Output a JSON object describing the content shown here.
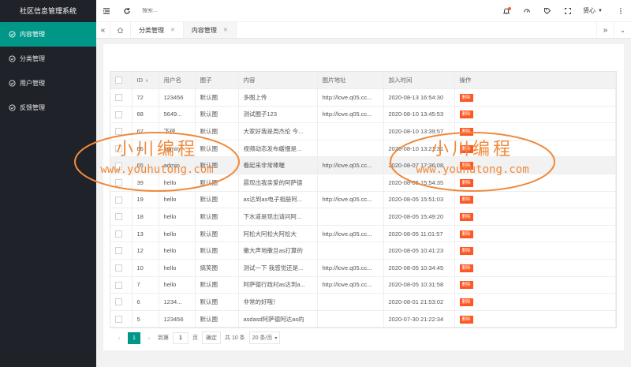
{
  "app": {
    "title": "社区信息管理系统"
  },
  "sidebar": {
    "items": [
      {
        "label": "内容管理",
        "icon": "check-circle-icon",
        "active": true
      },
      {
        "label": "分类管理",
        "icon": "check-circle-icon",
        "active": false
      },
      {
        "label": "用户管理",
        "icon": "check-circle-icon",
        "active": false
      },
      {
        "label": "反馈管理",
        "icon": "check-circle-icon",
        "active": false
      }
    ]
  },
  "header": {
    "search_placeholder": "搜索...",
    "user": "贤心"
  },
  "tabs": [
    {
      "label": "分类管理",
      "active": false
    },
    {
      "label": "内容管理",
      "active": true
    }
  ],
  "table": {
    "columns": [
      "ID",
      "用户名",
      "圈子",
      "内容",
      "图片地址",
      "加入时间",
      "操作"
    ],
    "delete_label": "删除",
    "rows": [
      {
        "id": "72",
        "user": "123456",
        "circle": "默认圈",
        "content": "多图上传",
        "img": "http://love.q05.cc...",
        "time": "2020-08-13 16:54:30"
      },
      {
        "id": "68",
        "user": "5649...",
        "circle": "默认圈",
        "content": "测试圈子123",
        "img": "http://love.q05.cc...",
        "time": "2020-08-10 13:45:53"
      },
      {
        "id": "67",
        "user": "下径",
        "circle": "默认圈",
        "content": "大家好我是周杰伦 今...",
        "img": "",
        "time": "2020-08-10 13:39:57"
      },
      {
        "id": "66",
        "user": "admin",
        "circle": "默认圈",
        "content": "视频动态发布缓慢是...",
        "img": "",
        "time": "2020-08-10 13:21:31"
      },
      {
        "id": "65",
        "user": "admin",
        "circle": "默认圈",
        "content": "看起来非常棒喔",
        "img": "http://love.q05.cc...",
        "time": "2020-08-07 17:36:08"
      },
      {
        "id": "39",
        "user": "hello",
        "circle": "默认圈",
        "content": "晨现出我亲爱的阿萨德",
        "img": "",
        "time": "2020-08-05 15:54:35"
      },
      {
        "id": "19",
        "user": "hello",
        "circle": "默认圈",
        "content": "as达到as电子相册阿...",
        "img": "http://love.q05.cc...",
        "time": "2020-08-05 15:51:03"
      },
      {
        "id": "18",
        "user": "hello",
        "circle": "默认圈",
        "content": "下水道是现出请问阿...",
        "img": "",
        "time": "2020-08-05 15:49:20"
      },
      {
        "id": "13",
        "user": "hello",
        "circle": "默认圈",
        "content": "阿松大阿松大阿松大",
        "img": "http://love.q05.cc...",
        "time": "2020-08-05 11:01:57"
      },
      {
        "id": "12",
        "user": "hello",
        "circle": "默认圈",
        "content": "撒大声地撒旦as打算的",
        "img": "",
        "time": "2020-08-05 10:41:23"
      },
      {
        "id": "10",
        "user": "hello",
        "circle": "搞笑圈",
        "content": "测试一下 我感觉还是...",
        "img": "http://love.q05.cc...",
        "time": "2020-08-05 10:34:45"
      },
      {
        "id": "7",
        "user": "hello",
        "circle": "默认圈",
        "content": "阿萨德行政村as达到a...",
        "img": "http://love.q05.cc...",
        "time": "2020-08-05 10:31:58"
      },
      {
        "id": "6",
        "user": "1234...",
        "circle": "默认圈",
        "content": "非常的好哦！",
        "img": "",
        "time": "2020-08-01 21:53:02"
      },
      {
        "id": "5",
        "user": "123456",
        "circle": "默认圈",
        "content": "asdasd阿萨德阿达as的",
        "img": "",
        "time": "2020-07-30 21:22:34"
      }
    ]
  },
  "pager": {
    "current": "1",
    "goto_label": "到第",
    "goto_value": "1",
    "page_label": "页",
    "confirm_label": "确定",
    "total_label": "共 10 条",
    "per_page_label": "20 条/页"
  },
  "watermark": {
    "title": "小川编程",
    "url": "www.youhutong.com",
    "color": "#f08a3c"
  }
}
